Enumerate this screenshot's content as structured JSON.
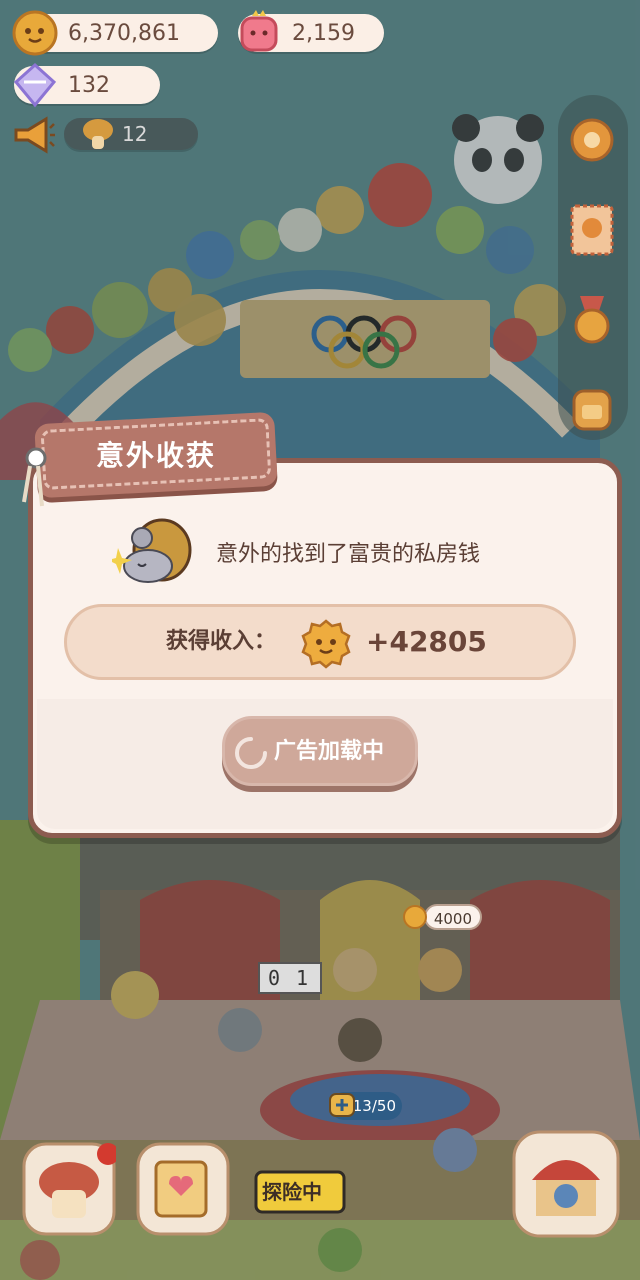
{
  "hud": {
    "coins": "6,370,861",
    "hearts": "2,159",
    "gems": "132",
    "visitors": "12"
  },
  "dialog": {
    "title": "意外收获",
    "description": "意外的找到了富贵的私房钱",
    "reward_label": "获得收入：",
    "reward_value": "+42805",
    "ad_button_label": "广告加载中"
  },
  "scene": {
    "price_tag": "4000",
    "capacity": "13/50",
    "explore_label": "探险中",
    "scoreboard": [
      "0",
      "1"
    ]
  },
  "colors": {
    "dialog_border": "#8c5c50",
    "title_tag": "#b5776a",
    "reward_bar": "#f3dccb",
    "ad_button": "#cfa89a"
  }
}
